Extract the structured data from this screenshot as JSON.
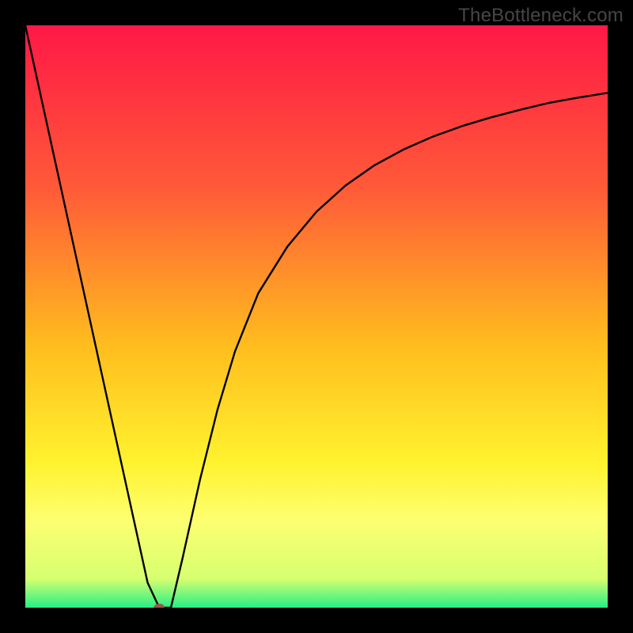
{
  "watermark": "TheBottleneck.com",
  "chart_data": {
    "type": "line",
    "title": "",
    "xlabel": "",
    "ylabel": "",
    "xlim": [
      0,
      100
    ],
    "ylim": [
      0,
      100
    ],
    "grid": false,
    "legend": false,
    "series": [
      {
        "name": "curve",
        "x": [
          0,
          5,
          10,
          15,
          17,
          19,
          21,
          23,
          24,
          25,
          27,
          30,
          33,
          36,
          40,
          45,
          50,
          55,
          60,
          65,
          70,
          75,
          80,
          85,
          90,
          95,
          100
        ],
        "values": [
          100,
          77.2,
          54.4,
          31.6,
          22.5,
          13.4,
          4.3,
          0,
          0,
          0,
          8.5,
          22,
          34,
          44,
          54,
          62,
          68,
          72.5,
          76,
          78.7,
          80.9,
          82.7,
          84.2,
          85.5,
          86.7,
          87.6,
          88.4
        ],
        "color": "#000000"
      }
    ],
    "marker": {
      "x": 23,
      "y": 0,
      "color": "#a05048",
      "shape": "ellipse"
    },
    "background_gradient": {
      "type": "vertical",
      "stops": [
        {
          "pos": 0.0,
          "color": "#ff1846"
        },
        {
          "pos": 0.28,
          "color": "#ff5a38"
        },
        {
          "pos": 0.55,
          "color": "#ffbd1e"
        },
        {
          "pos": 0.75,
          "color": "#fff22e"
        },
        {
          "pos": 0.85,
          "color": "#fdff70"
        },
        {
          "pos": 0.95,
          "color": "#d7ff70"
        },
        {
          "pos": 1.0,
          "color": "#26ef86"
        }
      ]
    }
  }
}
